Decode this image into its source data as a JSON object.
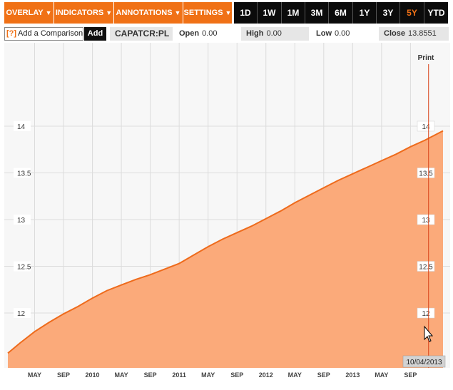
{
  "toolbar": {
    "menus": [
      {
        "label": "OVERLAY",
        "name": "overlay-menu"
      },
      {
        "label": "INDICATORS",
        "name": "indicators-menu"
      },
      {
        "label": "ANNOTATIONS",
        "name": "annotations-menu"
      },
      {
        "label": "SETTINGS",
        "name": "settings-menu"
      }
    ],
    "ranges": [
      "1D",
      "1W",
      "1M",
      "3M",
      "6M",
      "1Y",
      "3Y",
      "5Y",
      "YTD"
    ],
    "active_range": "5Y",
    "accent_color": "#f07116"
  },
  "info": {
    "compare_placeholder": "Add a Comparison",
    "help_icon": "[?]",
    "add_label": "Add",
    "ticker": "CAPATCR:PL",
    "open_label": "Open",
    "open_value": "0.00",
    "high_label": "High",
    "high_value": "0.00",
    "low_label": "Low",
    "low_value": "0.00",
    "close_label": "Close",
    "close_value": "13.8551"
  },
  "print_label": "Print",
  "cursor_date": "10/04/2013",
  "chart_data": {
    "type": "area",
    "ylim": [
      11.55,
      14.45
    ],
    "yticks": [
      12,
      12.5,
      13,
      13.5,
      14
    ],
    "xtick_labels": [
      "MAY",
      "SEP",
      "2010",
      "MAY",
      "SEP",
      "2011",
      "MAY",
      "SEP",
      "2012",
      "MAY",
      "SEP",
      "2013",
      "MAY",
      "SEP"
    ],
    "xtick_positions": [
      4,
      8,
      12,
      16,
      20,
      24,
      28,
      32,
      36,
      40,
      44,
      48,
      52,
      56
    ],
    "x_label_unit": "months since Jan 2009",
    "x_range": [
      0.3,
      60.5
    ],
    "cursor_x": 58.5,
    "fill_color": "#fbaa7a",
    "line_color": "#ee6b1c",
    "points": [
      [
        0.3,
        11.57
      ],
      [
        2,
        11.68
      ],
      [
        4,
        11.8
      ],
      [
        6,
        11.9
      ],
      [
        8,
        11.99
      ],
      [
        10,
        12.07
      ],
      [
        12,
        12.16
      ],
      [
        14,
        12.24
      ],
      [
        16,
        12.3
      ],
      [
        18,
        12.36
      ],
      [
        20,
        12.41
      ],
      [
        22,
        12.47
      ],
      [
        24,
        12.53
      ],
      [
        26,
        12.62
      ],
      [
        28,
        12.71
      ],
      [
        30,
        12.79
      ],
      [
        32,
        12.86
      ],
      [
        34,
        12.93
      ],
      [
        36,
        13.01
      ],
      [
        38,
        13.09
      ],
      [
        40,
        13.18
      ],
      [
        42,
        13.26
      ],
      [
        44,
        13.34
      ],
      [
        46,
        13.42
      ],
      [
        48,
        13.49
      ],
      [
        50,
        13.56
      ],
      [
        52,
        13.63
      ],
      [
        54,
        13.7
      ],
      [
        56,
        13.78
      ],
      [
        58,
        13.85
      ],
      [
        60.5,
        13.95
      ]
    ]
  }
}
